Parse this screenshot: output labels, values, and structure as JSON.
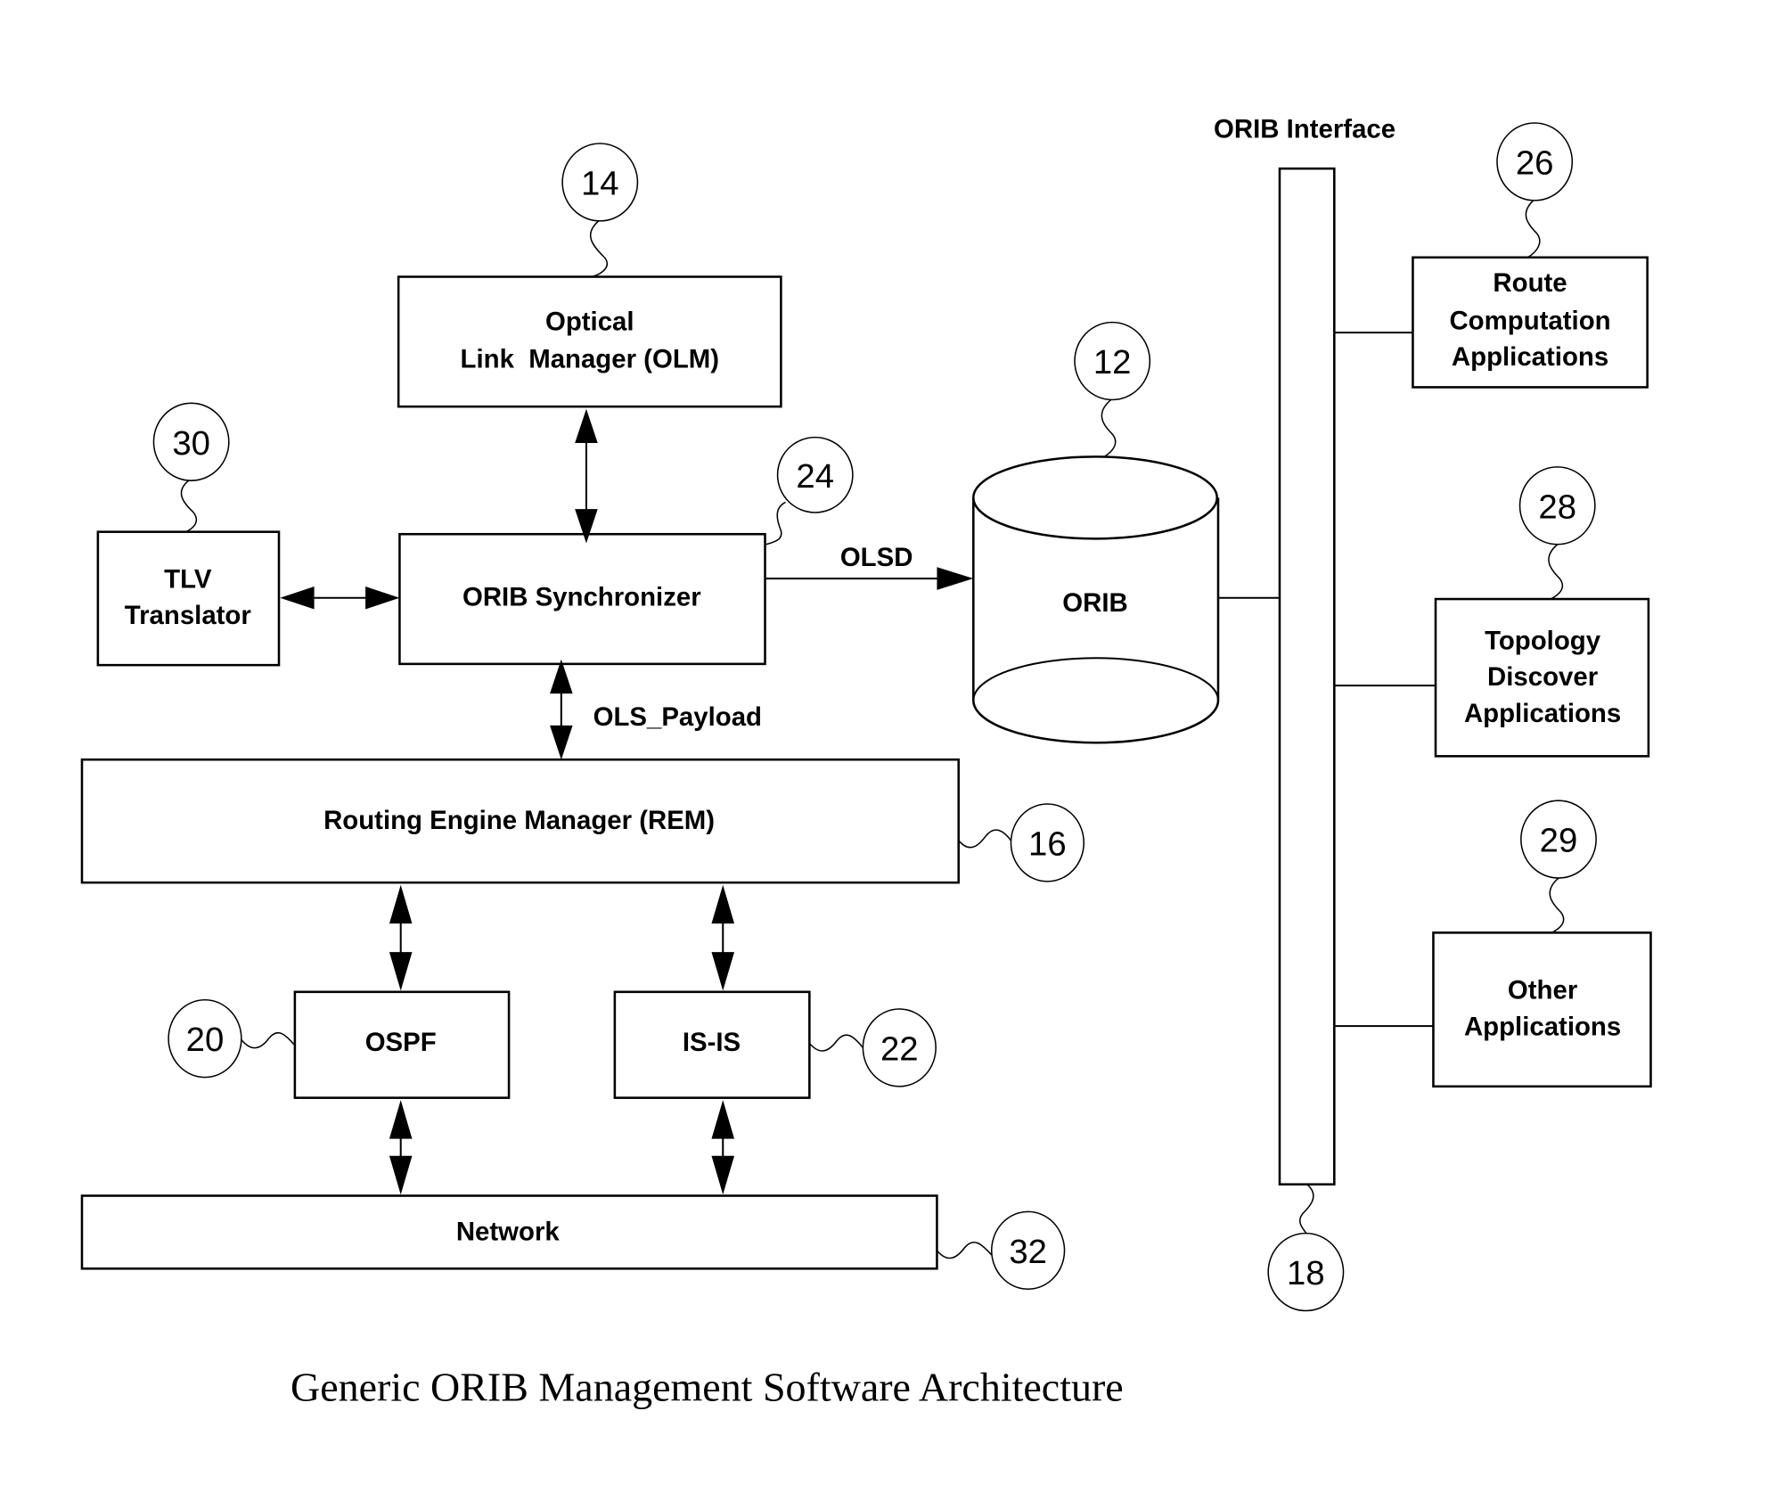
{
  "caption": "Generic ORIB Management Software Architecture",
  "interface_label": "ORIB Interface",
  "edge_labels": {
    "olsd": "OLSD",
    "ols_payload": "OLS_Payload"
  },
  "blocks": {
    "olm": {
      "lines": [
        "Optical",
        "Link  Manager (OLM)"
      ],
      "ref": "14"
    },
    "tlv": {
      "lines": [
        "TLV",
        "Translator"
      ],
      "ref": "30"
    },
    "sync": {
      "lines": [
        "ORIB Synchronizer"
      ],
      "ref": "24"
    },
    "orib": {
      "lines": [
        "ORIB"
      ],
      "ref": "12"
    },
    "rem": {
      "lines": [
        "Routing Engine Manager (REM)"
      ],
      "ref": "16"
    },
    "ospf": {
      "lines": [
        "OSPF"
      ],
      "ref": "20"
    },
    "isis": {
      "lines": [
        "IS-IS"
      ],
      "ref": "22"
    },
    "network": {
      "lines": [
        "Network"
      ],
      "ref": "32"
    },
    "route": {
      "lines": [
        "Route",
        "Computation",
        "Applications"
      ],
      "ref": "26"
    },
    "topology": {
      "lines": [
        "Topology",
        "Discover",
        "Applications"
      ],
      "ref": "28"
    },
    "other": {
      "lines": [
        "Other",
        "Applications"
      ],
      "ref": "29"
    },
    "bus": {
      "ref": "18"
    }
  }
}
